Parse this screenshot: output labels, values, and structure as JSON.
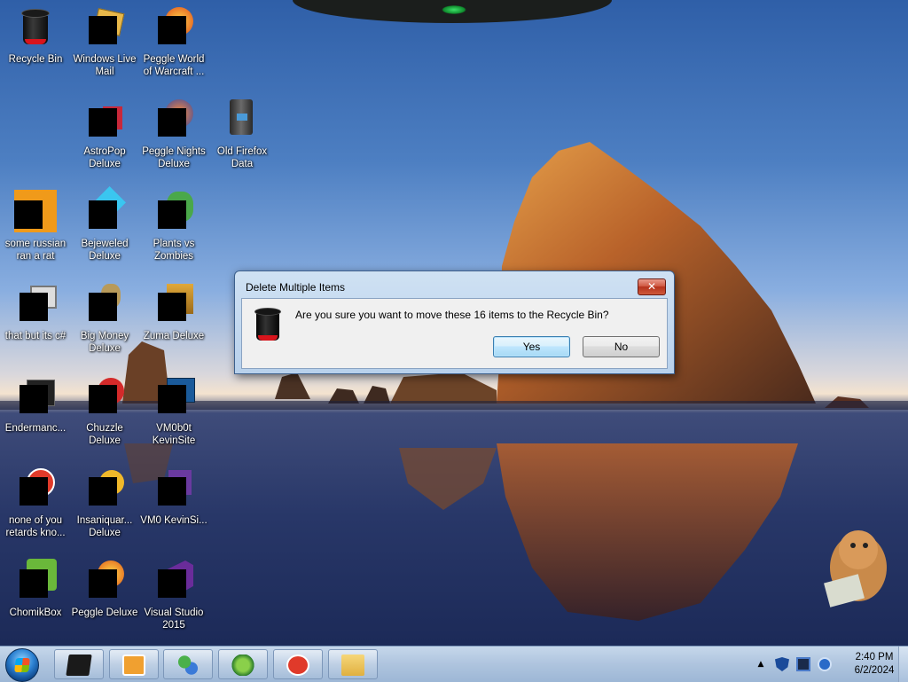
{
  "desktop": {
    "icons": [
      {
        "label": "Recycle Bin"
      },
      {
        "label": "Windows Live Mail"
      },
      {
        "label": "Peggle World of Warcraft ..."
      },
      {
        "label": "AstroPop Deluxe"
      },
      {
        "label": "Peggle Nights Deluxe"
      },
      {
        "label": "Old Firefox Data"
      },
      {
        "label": "some russian ran a rat"
      },
      {
        "label": "Bejeweled Deluxe"
      },
      {
        "label": "Plants vs Zombies"
      },
      {
        "label": "that but its c#"
      },
      {
        "label": "Big Money Deluxe"
      },
      {
        "label": "Zuma Deluxe"
      },
      {
        "label": "Endermanc..."
      },
      {
        "label": "Chuzzle Deluxe"
      },
      {
        "label": "VM0b0t KevinSite"
      },
      {
        "label": "none of you retards kno..."
      },
      {
        "label": "Insaniquar... Deluxe"
      },
      {
        "label": "VM0 KevinSi..."
      },
      {
        "label": "ChomikBox"
      },
      {
        "label": "Peggle Deluxe"
      },
      {
        "label": "Visual Studio 2015"
      }
    ]
  },
  "dialog": {
    "title": "Delete Multiple Items",
    "close_label": "✕",
    "message": "Are you sure you want to move these 16 items to the Recycle Bin?",
    "yes_label": "Yes",
    "no_label": "No",
    "icon": "recycle-bin-icon"
  },
  "taskbar": {
    "start_icon": "windows-start-orb",
    "pinned": [
      {
        "icon": "black-box-icon"
      },
      {
        "icon": "media-player-icon"
      },
      {
        "icon": "network-users-icon"
      },
      {
        "icon": "plants-vs-zombies-icon"
      },
      {
        "icon": "bird-game-icon"
      },
      {
        "icon": "folder-icon"
      }
    ],
    "tray": {
      "time": "2:40 PM",
      "date": "6/2/2024",
      "icons": [
        "show-hidden-icon",
        "security-shield-icon",
        "display-icon",
        "network-icon"
      ]
    }
  },
  "colors": {
    "accent": "#3c7fb1",
    "close_red": "#c84a30",
    "taskbar": "#aec4de"
  }
}
